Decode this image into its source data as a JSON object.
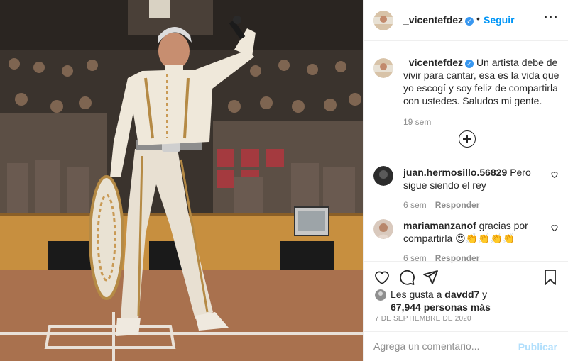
{
  "post": {
    "username": "_vicentefdez",
    "follow_label": "Seguir",
    "separator": "•",
    "more_label": "···",
    "verified_icon": "verified-badge-icon"
  },
  "caption": {
    "username": "_vicentefdez",
    "text": "Un artista debe de vivir para cantar, esa es la vida que yo escogí y soy feliz de compartirla con ustedes. Saludos mi gente.",
    "time": "19 sem"
  },
  "comments": [
    {
      "username": "juan.hermosillo.56829",
      "text": "Pero sigue siendo el rey",
      "time": "6 sem",
      "reply_label": "Responder"
    },
    {
      "username": "mariamanzanof",
      "text": "gracias por compartirla 😍👏👏👏👏",
      "time": "6 sem",
      "reply_label": "Responder"
    }
  ],
  "likes": {
    "prefix": "Les gusta a ",
    "user": "davdd7",
    "conj": " y",
    "others": "67,944 personas más"
  },
  "date": "7 DE SEPTIEMBRE DE 2020",
  "add_comment": {
    "placeholder": "Agrega un comentario...",
    "publish_label": "Publicar"
  },
  "colors": {
    "accent": "#0095f6",
    "publish_disabled": "#b2dffc",
    "muted": "#8e8e8e"
  }
}
